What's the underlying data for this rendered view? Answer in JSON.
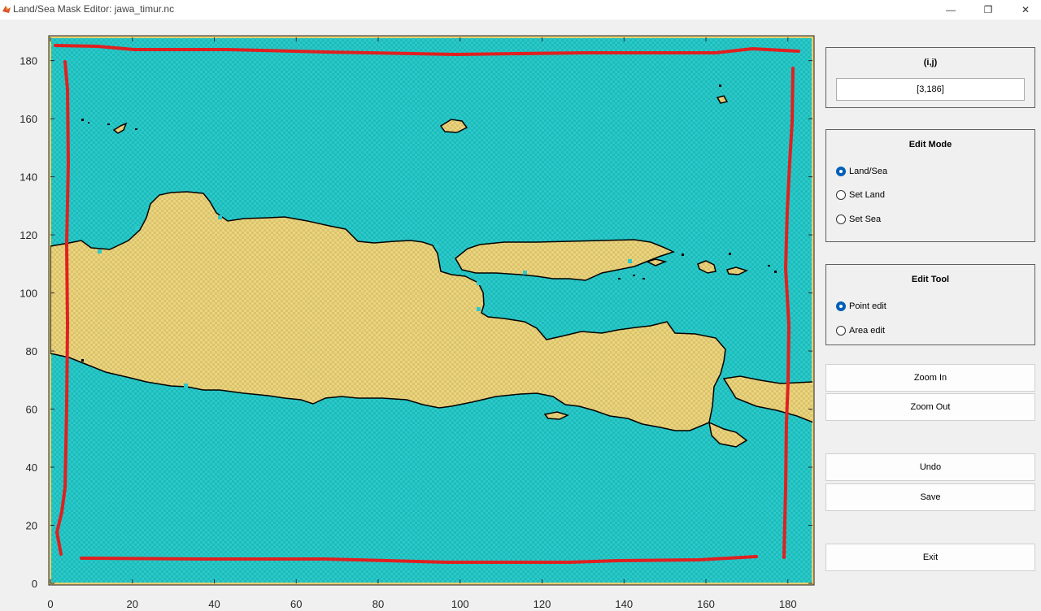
{
  "window": {
    "title": "Land/Sea Mask Editor:  jawa_timur.nc",
    "minimize_glyph": "—",
    "restore_glyph": "❐",
    "close_glyph": "✕"
  },
  "chart_data": {
    "type": "heatmap",
    "title": "",
    "xlabel": "",
    "ylabel": "",
    "xlim": [
      0,
      186
    ],
    "ylim": [
      0,
      188
    ],
    "x_ticks": [
      "0",
      "20",
      "40",
      "60",
      "80",
      "100",
      "120",
      "140",
      "160",
      "180"
    ],
    "y_ticks": [
      "0",
      "20",
      "40",
      "60",
      "80",
      "100",
      "120",
      "140",
      "160",
      "180"
    ],
    "colors": {
      "sea": "#2ec8c8",
      "land": "#e8d27c",
      "coastline": "#000000",
      "selection": "#e02020"
    }
  },
  "ij_panel": {
    "title": "(i,j)",
    "value": "[3,186]"
  },
  "edit_mode": {
    "title": "Edit Mode",
    "options": [
      {
        "label": "Land/Sea",
        "selected": true
      },
      {
        "label": "Set Land",
        "selected": false
      },
      {
        "label": "Set Sea",
        "selected": false
      }
    ]
  },
  "edit_tool": {
    "title": "Edit Tool",
    "options": [
      {
        "label": "Point edit",
        "selected": true
      },
      {
        "label": "Area edit",
        "selected": false
      }
    ]
  },
  "buttons": {
    "zoom_in": "Zoom In",
    "zoom_out": "Zoom Out",
    "undo": "Undo",
    "save": "Save",
    "exit": "Exit"
  }
}
